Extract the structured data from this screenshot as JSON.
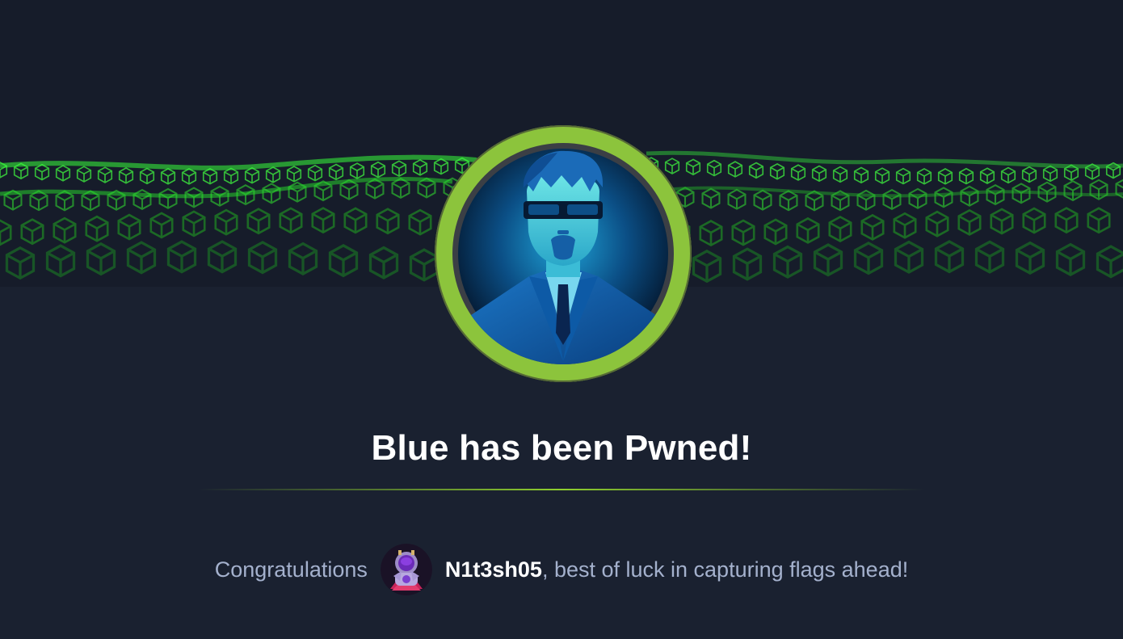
{
  "machine": {
    "name": "Blue",
    "pwned_title": "Blue has been Pwned!"
  },
  "message": {
    "prefix": "Congratulations",
    "username": "N1t3sh05",
    "suffix": ", best of luck in capturing flags ahead!"
  },
  "icons": {
    "banner": "green-cube-wave-banner",
    "machine_avatar": "agent-in-suit-avatar-icon",
    "user_avatar": "astronaut-avatar-icon"
  },
  "colors": {
    "background": "#1a2130",
    "ring": "#8cc43c",
    "accent_green": "#9fef00",
    "text_muted": "#a4b1cd",
    "text_white": "#ffffff"
  }
}
